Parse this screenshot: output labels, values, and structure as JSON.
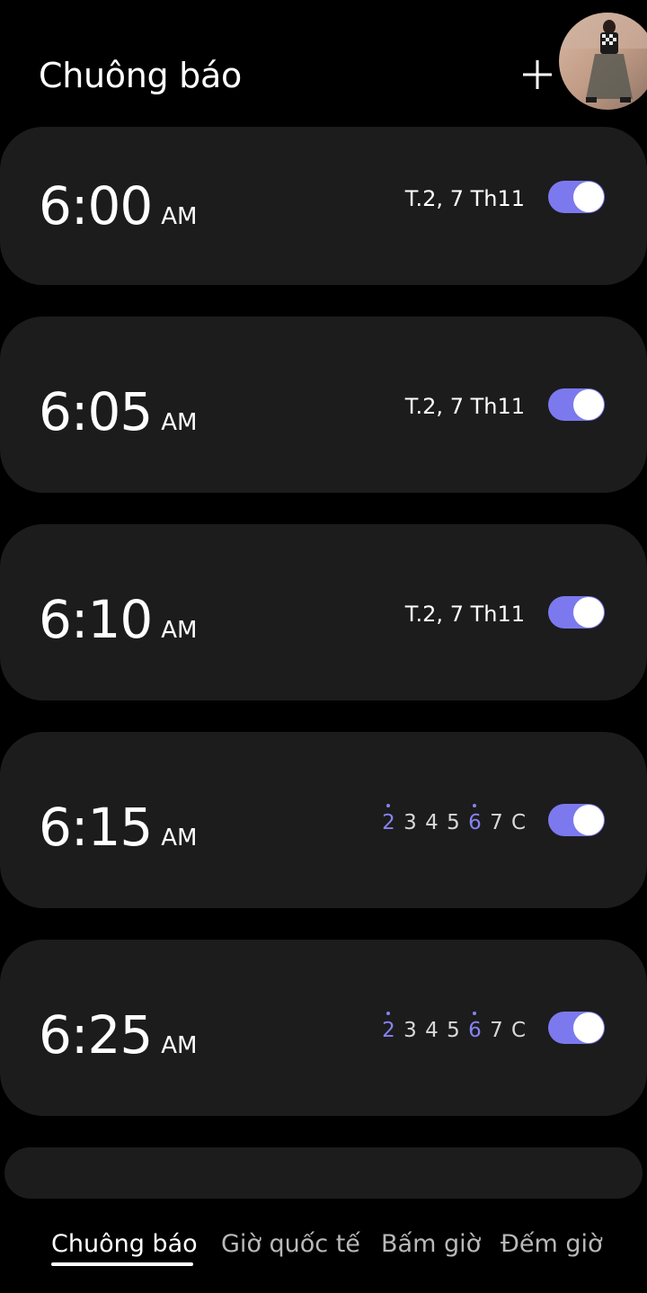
{
  "header": {
    "title": "Chuông báo"
  },
  "alarms": [
    {
      "time": "6:00",
      "ampm": "AM",
      "date": "T.2, 7 Th11",
      "enabled": true
    },
    {
      "time": "6:05",
      "ampm": "AM",
      "date": "T.2, 7 Th11",
      "enabled": true
    },
    {
      "time": "6:10",
      "ampm": "AM",
      "date": "T.2, 7 Th11",
      "enabled": true
    },
    {
      "time": "6:15",
      "ampm": "AM",
      "days": [
        "2",
        "3",
        "4",
        "5",
        "6",
        "7",
        "C"
      ],
      "active_days": [
        "2",
        "6"
      ],
      "enabled": true
    },
    {
      "time": "6:25",
      "ampm": "AM",
      "days": [
        "2",
        "3",
        "4",
        "5",
        "6",
        "7",
        "C"
      ],
      "active_days": [
        "2",
        "6"
      ],
      "enabled": true
    }
  ],
  "bottom_nav": {
    "tabs": [
      {
        "label": "Chuông báo",
        "active": true
      },
      {
        "label": "Giờ quốc tế",
        "active": false
      },
      {
        "label": "Bấm giờ",
        "active": false
      },
      {
        "label": "Đếm giờ",
        "active": false
      }
    ]
  },
  "colors": {
    "accent": "#7c79ef",
    "card": "#1c1c1d",
    "background": "#000000"
  },
  "icons": {
    "add": "plus-icon",
    "avatar": "profile-avatar"
  }
}
